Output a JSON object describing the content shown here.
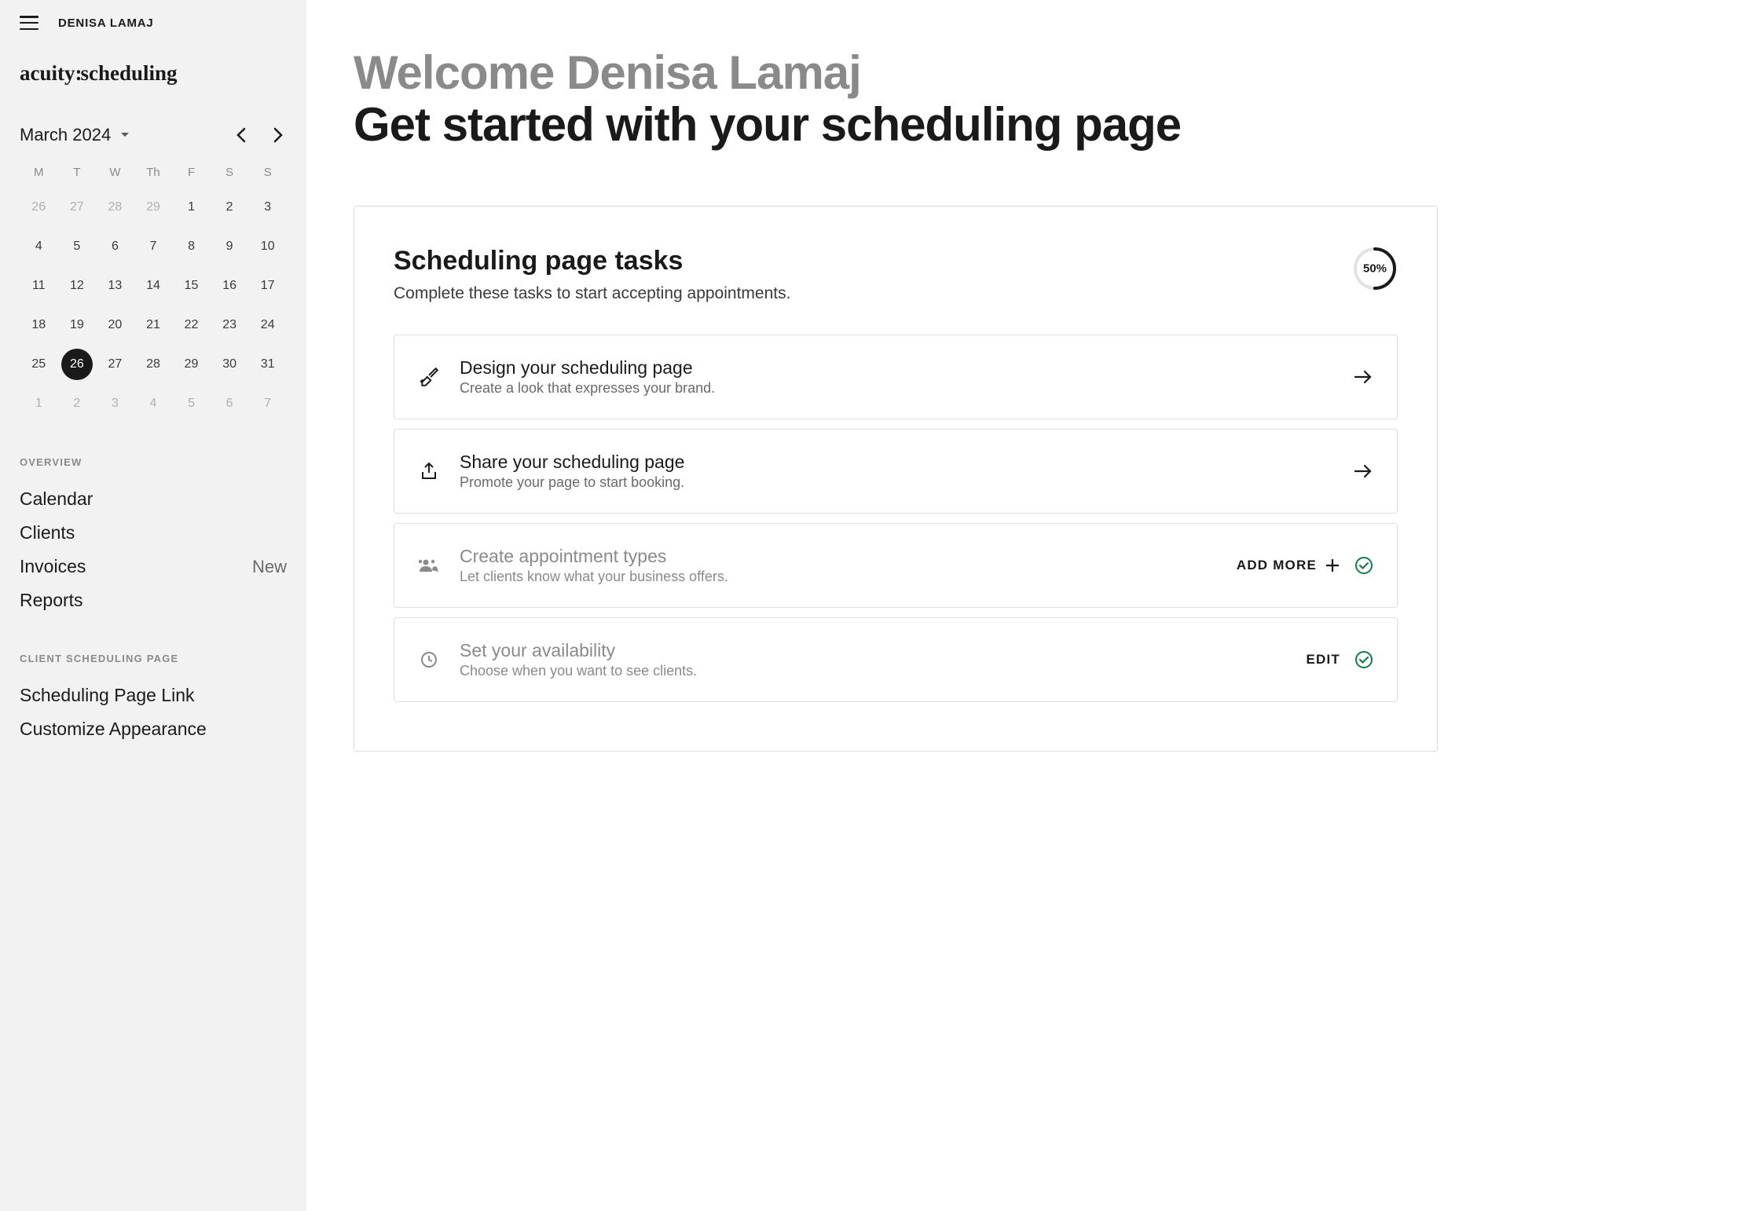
{
  "user": {
    "name": "DENISA LAMAJ"
  },
  "brand": {
    "prefix": "acuity",
    "sep": ":",
    "suffix": "scheduling"
  },
  "calendar": {
    "month_label": "March 2024",
    "dow": [
      "M",
      "T",
      "W",
      "Th",
      "F",
      "S",
      "S"
    ],
    "weeks": [
      [
        {
          "d": "26",
          "muted": true
        },
        {
          "d": "27",
          "muted": true
        },
        {
          "d": "28",
          "muted": true
        },
        {
          "d": "29",
          "muted": true
        },
        {
          "d": "1"
        },
        {
          "d": "2"
        },
        {
          "d": "3"
        }
      ],
      [
        {
          "d": "4"
        },
        {
          "d": "5"
        },
        {
          "d": "6"
        },
        {
          "d": "7"
        },
        {
          "d": "8"
        },
        {
          "d": "9"
        },
        {
          "d": "10"
        }
      ],
      [
        {
          "d": "11"
        },
        {
          "d": "12"
        },
        {
          "d": "13"
        },
        {
          "d": "14"
        },
        {
          "d": "15"
        },
        {
          "d": "16"
        },
        {
          "d": "17"
        }
      ],
      [
        {
          "d": "18"
        },
        {
          "d": "19"
        },
        {
          "d": "20"
        },
        {
          "d": "21"
        },
        {
          "d": "22"
        },
        {
          "d": "23"
        },
        {
          "d": "24"
        }
      ],
      [
        {
          "d": "25"
        },
        {
          "d": "26",
          "selected": true
        },
        {
          "d": "27"
        },
        {
          "d": "28"
        },
        {
          "d": "29"
        },
        {
          "d": "30"
        },
        {
          "d": "31"
        }
      ],
      [
        {
          "d": "1",
          "muted": true
        },
        {
          "d": "2",
          "muted": true
        },
        {
          "d": "3",
          "muted": true
        },
        {
          "d": "4",
          "muted": true
        },
        {
          "d": "5",
          "muted": true
        },
        {
          "d": "6",
          "muted": true
        },
        {
          "d": "7",
          "muted": true
        }
      ]
    ]
  },
  "nav": {
    "overview_header": "OVERVIEW",
    "overview": [
      {
        "label": "Calendar"
      },
      {
        "label": "Clients"
      },
      {
        "label": "Invoices",
        "badge": "New"
      },
      {
        "label": "Reports"
      }
    ],
    "client_header": "CLIENT SCHEDULING PAGE",
    "client_items": [
      {
        "label": "Scheduling Page Link"
      },
      {
        "label": "Customize Appearance"
      }
    ]
  },
  "main": {
    "welcome": "Welcome Denisa Lamaj",
    "subheading": "Get started with your scheduling page",
    "tasks_title": "Scheduling page tasks",
    "tasks_desc": "Complete these tasks to start accepting appointments.",
    "progress_pct": 50,
    "progress_label": "50%",
    "tasks": [
      {
        "icon": "paintbrush",
        "title": "Design your scheduling page",
        "sub": "Create a look that expresses your brand.",
        "action": "arrow",
        "done": false
      },
      {
        "icon": "share",
        "title": "Share your scheduling page",
        "sub": "Promote your page to start booking.",
        "action": "arrow",
        "done": false
      },
      {
        "icon": "people",
        "title": "Create appointment types",
        "sub": "Let clients know what your business offers.",
        "action": "add",
        "action_label": "ADD MORE",
        "done": true
      },
      {
        "icon": "clock",
        "title": "Set your availability",
        "sub": "Choose when you want to see clients.",
        "action": "edit",
        "action_label": "EDIT",
        "done": true
      }
    ]
  },
  "colors": {
    "accent_green": "#167a4a"
  }
}
